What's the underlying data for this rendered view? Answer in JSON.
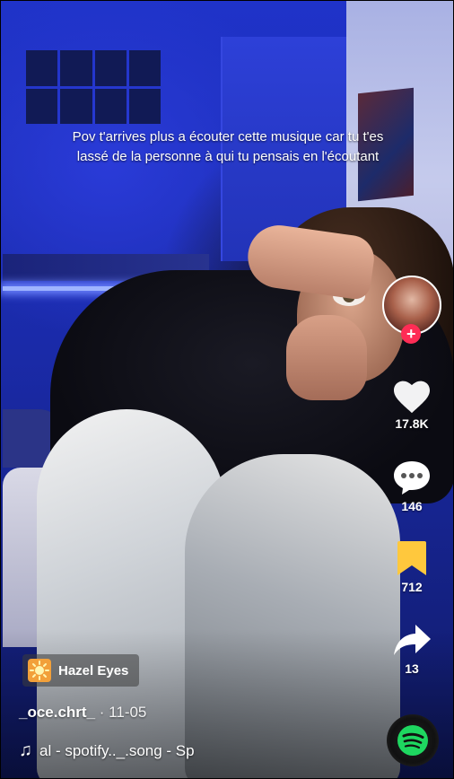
{
  "caption": {
    "line1": "Pov t'arrives plus a écouter cette musique car tu t'es",
    "line2": "lassé de la personne à qui tu pensais en l'écoutant"
  },
  "actions": {
    "likes": "17.8K",
    "comments": "146",
    "saves": "712",
    "shares": "13"
  },
  "follow": {
    "symbol": "+"
  },
  "effect": {
    "name": "Hazel Eyes"
  },
  "author": {
    "username": "_oce.chrt_",
    "date": "· 11-05"
  },
  "music": {
    "note": "♫",
    "title": "al - spotify.._.song - Sp"
  },
  "colors": {
    "follow": "#fe2c55",
    "save": "#ffc83d",
    "spotify": "#1ed760"
  }
}
